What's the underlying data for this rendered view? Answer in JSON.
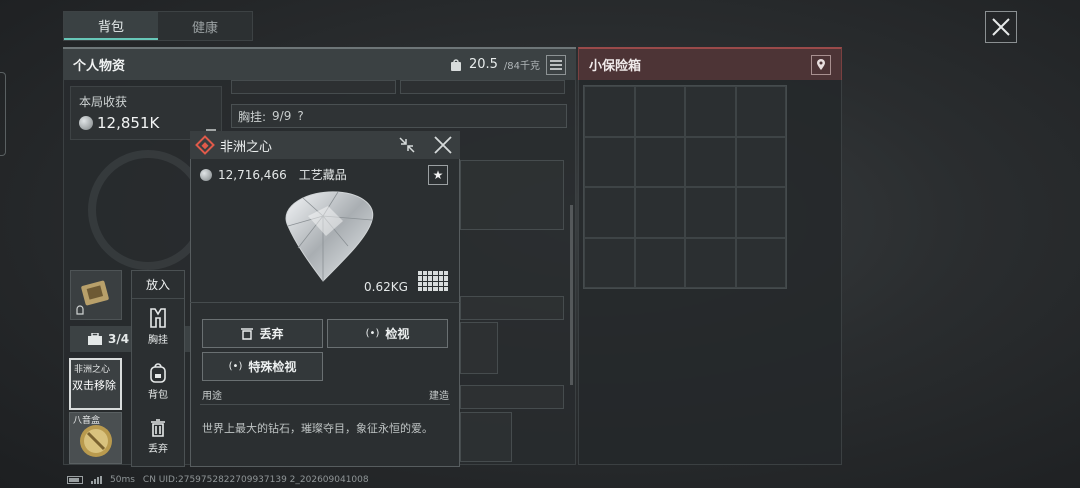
{
  "tabs": [
    {
      "label": "背包",
      "active": true
    },
    {
      "label": "健康",
      "active": false
    }
  ],
  "personal": {
    "title": "个人物资",
    "weight_current": "20.5",
    "weight_max": "/84千克"
  },
  "harvest": {
    "label": "本局收获",
    "value": "12,851K"
  },
  "chest": {
    "label": "胸挂:",
    "count": "9/9",
    "help": "?"
  },
  "backpack_count": "3/4",
  "item_tile": {
    "name": "非洲之心",
    "remove_hint": "双击移除",
    "name2": "八音盒"
  },
  "context_menu": {
    "title": "放入",
    "items": [
      {
        "label": "胸挂",
        "icon": "vest-icon"
      },
      {
        "label": "背包",
        "icon": "backpack-icon"
      },
      {
        "label": "丢弃",
        "icon": "trash-icon"
      }
    ]
  },
  "item_popup": {
    "title": "非洲之心",
    "price": "12,716,466",
    "category": "工艺藏品",
    "weight": "0.62KG",
    "actions": {
      "discard": "丢弃",
      "inspect": "检视",
      "special_inspect": "特殊检视"
    },
    "usage_label": "用途",
    "usage_value": "建造",
    "description": "世界上最大的钻石，璀璨夺目，象征永恒的爱。"
  },
  "safe_box": {
    "title": "小保险箱"
  },
  "status_bar": {
    "ping": "50ms",
    "uid": "CN UID:2759752822709937139 2_202609041008"
  },
  "colors": {
    "accent": "#67c7b8",
    "danger_header": "#4d3436",
    "item_icon": "#e05a4a"
  }
}
